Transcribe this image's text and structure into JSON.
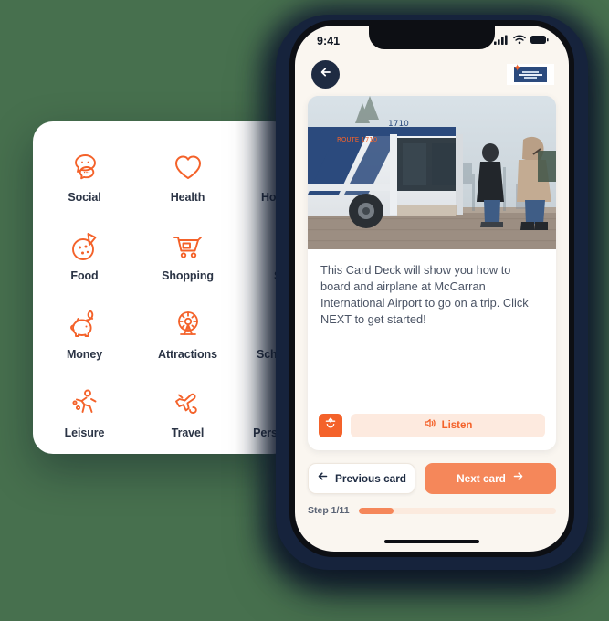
{
  "background_color": "#47704E",
  "accent_color": "#F4622A",
  "categories": {
    "items": [
      {
        "label": "Social",
        "icon": "speech-bubbles-icon"
      },
      {
        "label": "Health",
        "icon": "heart-icon"
      },
      {
        "label": "Home Care",
        "icon": "house-tree-icon"
      },
      {
        "label": "Food",
        "icon": "pizza-icon"
      },
      {
        "label": "Shopping",
        "icon": "shopping-cart-icon"
      },
      {
        "label": "Safety",
        "icon": "flame-icon"
      },
      {
        "label": "Money",
        "icon": "piggy-bank-icon"
      },
      {
        "label": "Attractions",
        "icon": "ferris-wheel-icon"
      },
      {
        "label": "School/Work",
        "icon": "backpack-icon"
      },
      {
        "label": "Leisure",
        "icon": "running-person-icon"
      },
      {
        "label": "Travel",
        "icon": "airplane-icon"
      },
      {
        "label": "Personal Care",
        "icon": "tooth-brush-icon"
      }
    ]
  },
  "phone": {
    "status_bar": {
      "time": "9:41",
      "icons": [
        "cellular-signal-icon",
        "wifi-icon",
        "battery-icon"
      ]
    },
    "header": {
      "back_icon": "back-arrow-icon",
      "logo_name": "brand-logo"
    },
    "card": {
      "photo_alt": "city-bus-boarding-photo",
      "body_text": "This Card Deck will show you how to board and airplane at McCarran International Airport to go on a trip. Click NEXT to get started!",
      "replay_icon": "replay-face-icon",
      "listen_label": "Listen",
      "listen_icon": "speaker-icon"
    },
    "nav": {
      "previous_label": "Previous card",
      "previous_icon": "arrow-left-icon",
      "next_label": "Next card",
      "next_icon": "arrow-right-icon"
    },
    "progress": {
      "label": "Step 1/11",
      "current": 1,
      "total": 11,
      "percent": 18
    }
  }
}
